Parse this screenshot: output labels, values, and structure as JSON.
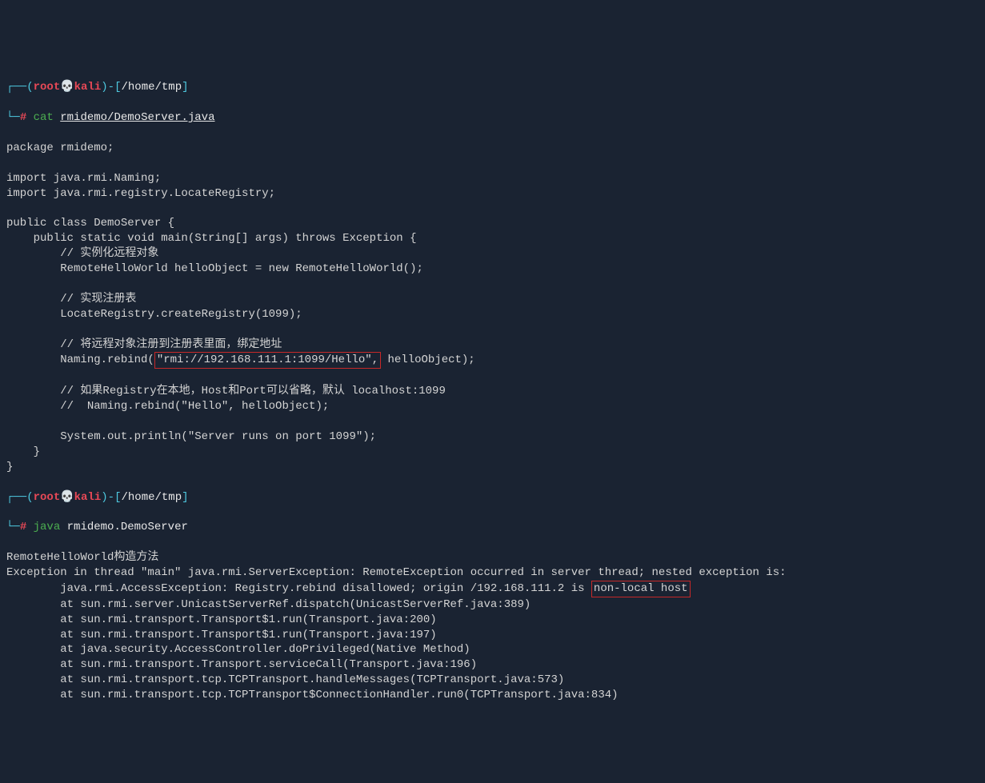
{
  "prompt1": {
    "open": "┌──(",
    "user": "root",
    "skull": "💀",
    "host": "kali",
    "close": ")-[",
    "path": "/home/tmp",
    "end": "]",
    "line2_prefix": "└─",
    "hash": "#",
    "cmd_cat": "cat",
    "cmd_arg": "rmidemo/DemoServer.java"
  },
  "source": {
    "l1": "package rmidemo;",
    "l2": "",
    "l3": "import java.rmi.Naming;",
    "l4": "import java.rmi.registry.LocateRegistry;",
    "l5": "",
    "l6": "public class DemoServer {",
    "l7": "    public static void main(String[] args) throws Exception {",
    "l8": "        // 实例化远程对象",
    "l9": "        RemoteHelloWorld helloObject = new RemoteHelloWorld();",
    "l10": "",
    "l11": "        // 实现注册表",
    "l12": "        LocateRegistry.createRegistry(1099);",
    "l13": "",
    "l14": "        // 将远程对象注册到注册表里面，绑定地址",
    "l15a": "        Naming.rebind(",
    "l15b": "\"rmi://192.168.111.1:1099/Hello\",",
    "l15c": " helloObject);",
    "l16": "",
    "l17": "        // 如果Registry在本地，Host和Port可以省略，默认 localhost:1099",
    "l18": "        //  Naming.rebind(\"Hello\", helloObject);",
    "l19": "",
    "l20": "        System.out.println(\"Server runs on port 1099\");",
    "l21": "    }",
    "l22": "}",
    "l23": ""
  },
  "prompt2": {
    "open": "┌──(",
    "user": "root",
    "skull": "💀",
    "host": "kali",
    "close": ")-[",
    "path": "/home/tmp",
    "end": "]",
    "line2_prefix": "└─",
    "hash": "#",
    "cmd_java": "java",
    "cmd_arg": "rmidemo.DemoServer"
  },
  "output": {
    "o1": "RemoteHelloWorld构造方法",
    "o2": "Exception in thread \"main\" java.rmi.ServerException: RemoteException occurred in server thread; nested exception is: ",
    "o3a": "        java.rmi.AccessException: Registry.rebind disallowed; origin /192.168.111.2 is ",
    "o3b": "non-local host",
    "o4": "        at sun.rmi.server.UnicastServerRef.dispatch(UnicastServerRef.java:389)",
    "o5": "        at sun.rmi.transport.Transport$1.run(Transport.java:200)",
    "o6": "        at sun.rmi.transport.Transport$1.run(Transport.java:197)",
    "o7": "        at java.security.AccessController.doPrivileged(Native Method)",
    "o8": "        at sun.rmi.transport.Transport.serviceCall(Transport.java:196)",
    "o9": "        at sun.rmi.transport.tcp.TCPTransport.handleMessages(TCPTransport.java:573)",
    "o10": "        at sun.rmi.transport.tcp.TCPTransport$ConnectionHandler.run0(TCPTransport.java:834)"
  }
}
